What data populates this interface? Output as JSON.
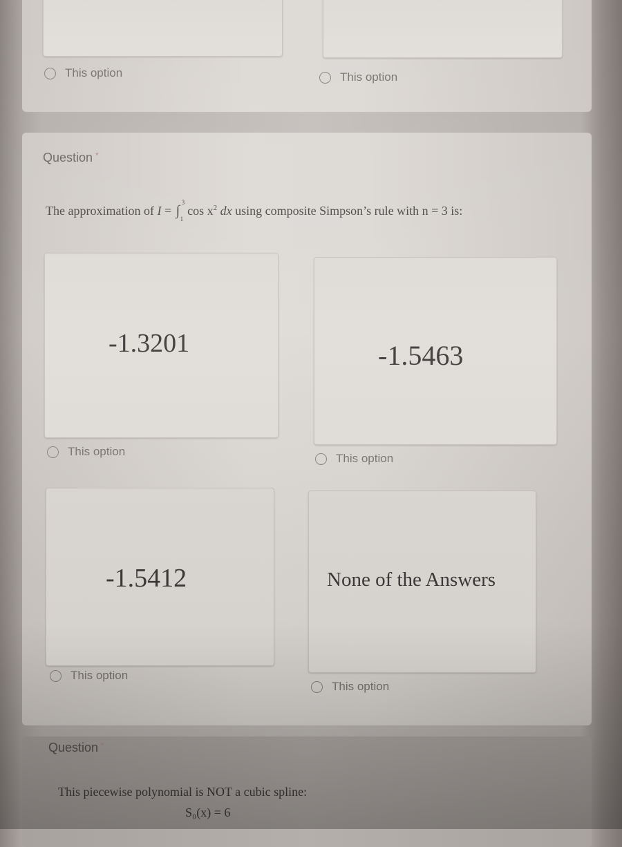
{
  "previous_question": {
    "options": [
      {
        "radio_label": "This option"
      },
      {
        "radio_label": "This option"
      }
    ]
  },
  "question1": {
    "label": "Question",
    "required_marker": "*",
    "text_prefix": "The approximation of ",
    "integral_var": "I",
    "equals": " = ",
    "integral_symbol": "∫",
    "upper_limit": "3",
    "lower_limit": "1",
    "integrand": "cos x",
    "integrand_exp": "2",
    "differential": " dx",
    "text_suffix": " using composite Simpson’s rule with n = 3 is:",
    "options": [
      {
        "value": "-1.3201",
        "radio_label": "This option"
      },
      {
        "value": "-1.5463",
        "radio_label": "This option"
      },
      {
        "value": "-1.5412",
        "radio_label": "This option"
      },
      {
        "value": "None of the Answers",
        "radio_label": "This option"
      }
    ]
  },
  "question2": {
    "label": "Question",
    "required_marker": "*",
    "text": "This piecewise polynomial is NOT a cubic spline:",
    "formula_partial": "S₀(x) = 6"
  }
}
